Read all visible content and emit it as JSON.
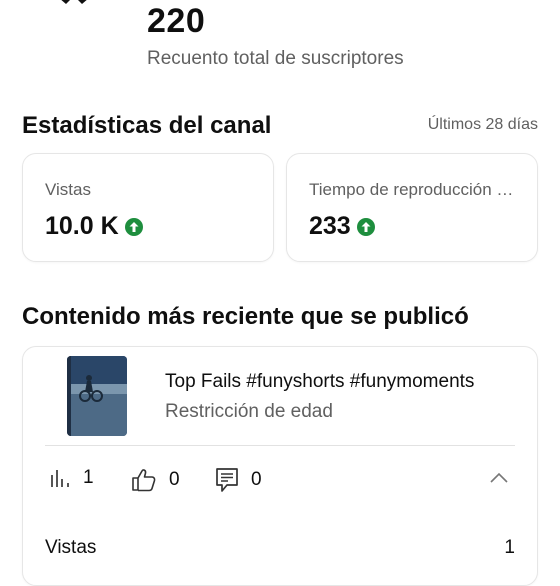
{
  "channel": {
    "subscriber_count": "220",
    "subscriber_label": "Recuento total de suscriptores"
  },
  "stats": {
    "title": "Estadísticas del canal",
    "period": "Últimos 28 días",
    "cards": [
      {
        "label": "Vistas",
        "value": "10.0 K",
        "trend": "up"
      },
      {
        "label": "Tiempo de reproducción (horas)",
        "value": "233",
        "trend": "up"
      }
    ],
    "trend_color": "#1e8e3e"
  },
  "recent": {
    "title": "Contenido más reciente que se publicó",
    "video": {
      "title": "Top Fails #funyshorts #funymoments",
      "status": "Restricción de edad",
      "views": "1",
      "likes": "0",
      "comments": "0"
    },
    "detail_rows": [
      {
        "label": "Vistas",
        "value": "1"
      }
    ]
  }
}
